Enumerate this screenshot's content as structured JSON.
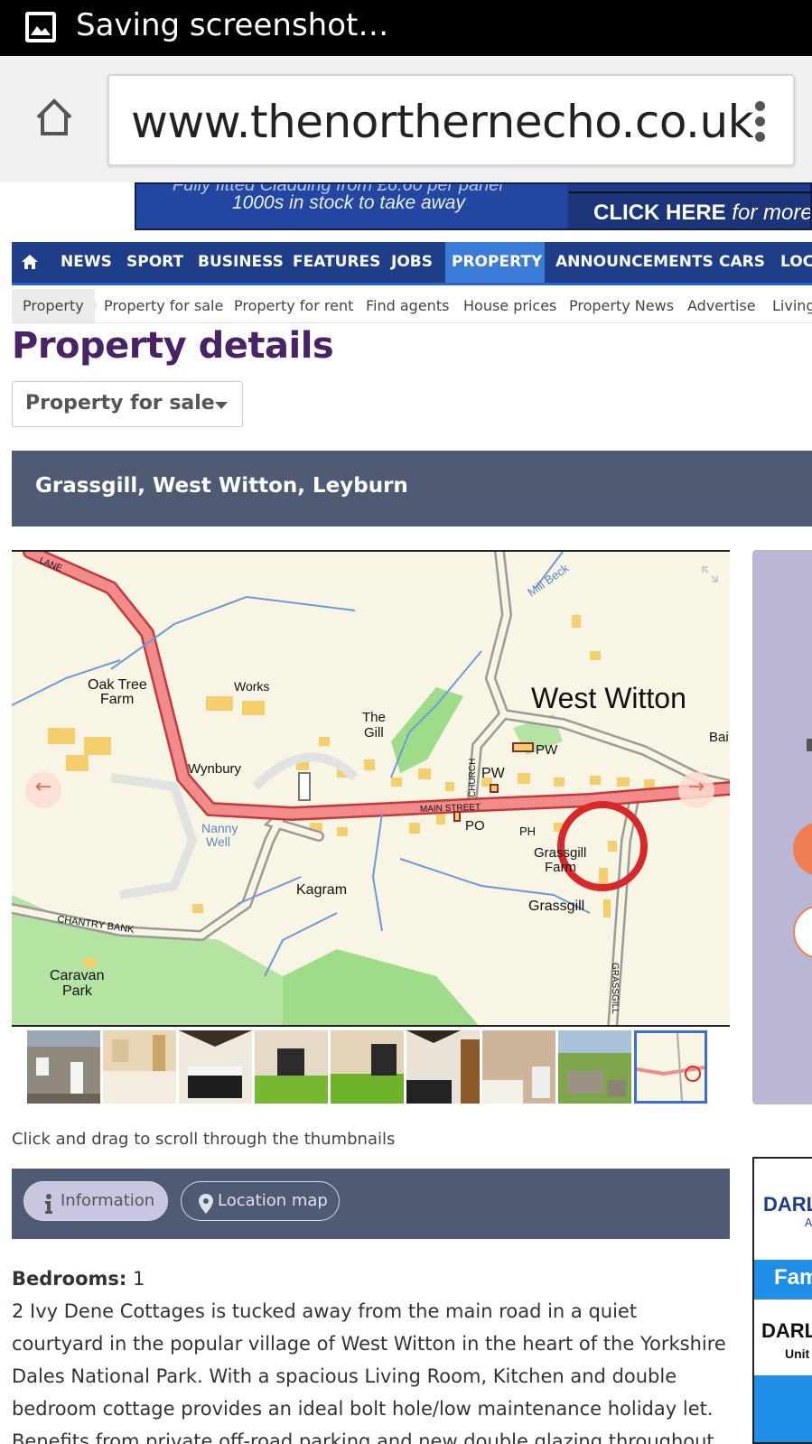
{
  "status_bar": {
    "text": "Saving screenshot…",
    "icon": "image-icon"
  },
  "browser": {
    "url": "www.thenorthernecho.co.uk",
    "home_icon": "home-icon",
    "menu_icon": "more-vert-icon"
  },
  "ad_banner": {
    "line1": "Fully fitted Cladding from £6.60 per panel",
    "line2": "1000s in stock to take away",
    "cta_bold": "CLICK HERE",
    "cta_rest": " for more"
  },
  "main_nav": {
    "home_icon": "home-icon",
    "items": [
      {
        "label": "NEWS"
      },
      {
        "label": "SPORT"
      },
      {
        "label": "BUSINESS"
      },
      {
        "label": "FEATURES"
      },
      {
        "label": "JOBS"
      },
      {
        "label": "PROPERTY",
        "active": true
      },
      {
        "label": "ANNOUNCEMENTS"
      },
      {
        "label": "CARS"
      },
      {
        "label": "LOCAL"
      }
    ]
  },
  "sub_nav": {
    "items": [
      {
        "label": "Property"
      },
      {
        "label": "Property for sale"
      },
      {
        "label": "Property for rent"
      },
      {
        "label": "Find agents"
      },
      {
        "label": "House prices"
      },
      {
        "label": "Property News"
      },
      {
        "label": "Advertise"
      },
      {
        "label": "Living"
      }
    ]
  },
  "page_title": "Property details",
  "category_select": {
    "value": "Property for sale"
  },
  "address": "Grassgill, West Witton, Leyburn",
  "gallery": {
    "map_labels": {
      "lane": "LANE",
      "mill_beck": "Mill Beck",
      "oak_tree_farm_1": "Oak Tree",
      "oak_tree_farm_2": "Farm",
      "works": "Works",
      "the_gill_1": "The",
      "the_gill_2": "Gill",
      "west_witton": "West Witton",
      "bai": "Bai",
      "pw1": "PW",
      "pw2": "PW",
      "church": "CHURCH",
      "wynbury": "Wynbury",
      "main_street": "MAIN   STREET",
      "po": "PO",
      "ph": "PH",
      "nanny_well_1": "Nanny",
      "nanny_well_2": "Well",
      "grassgill_farm_1": "Grassgill",
      "grassgill_farm_2": "Farm",
      "kagram": "Kagram",
      "grassgill": "Grassgill",
      "chantry_bank": "CHANTRY BANK",
      "caravan_park_1": "Caravan",
      "caravan_park_2": "Park",
      "grassgill_road": "GRASSGILL"
    },
    "prev_icon": "arrow-left-icon",
    "next_icon": "arrow-right-icon",
    "expand_icon": "expand-icon",
    "thumbnail_count": 9,
    "selected_thumbnail": 9
  },
  "drag_hint": "Click and drag to scroll through the thumbnails",
  "tabs": [
    {
      "label": "Information",
      "icon": "info-icon",
      "active": true
    },
    {
      "label": "Location map",
      "icon": "map-pin-icon",
      "active": false
    }
  ],
  "details": {
    "bedrooms_label": "Bedrooms:",
    "bedrooms_value": "1",
    "description": "2 Ivy Dene Cottages is tucked away from the main road in a quiet courtyard in the popular village of West Witton in the heart of the Yorkshire Dales National Park. With a spacious Living Room, Kitchen and double bedroom cottage provides an ideal bolt hole/low maintenance holiday let. Benefits from private off-road parking and new double glazing throughout. The contents are"
  },
  "side_ad": {
    "line1": "DARLIN",
    "line2": "A",
    "fam": "Fam",
    "line3": "DARL",
    "line4": "Unit"
  },
  "colors": {
    "nav_bg": "#1e3f87",
    "nav_active": "#3b7bd8",
    "title_purple": "#4a2366",
    "header_slate": "#4f5a75",
    "accent_orange": "#f08054"
  }
}
